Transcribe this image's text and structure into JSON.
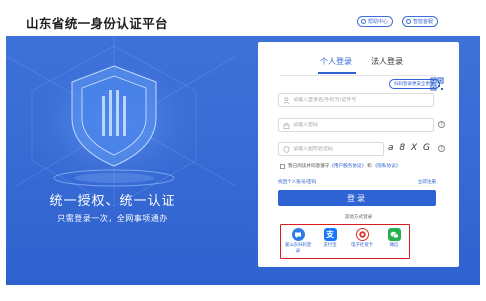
{
  "header": {
    "title": "山东省统一身份认证平台",
    "help_label": "帮助中心",
    "service_label": "智能客服"
  },
  "hero": {
    "slogan": "统一授权、统一认证",
    "subtitle": "只需登录一次，全网事项通办"
  },
  "login": {
    "tabs": [
      {
        "label": "个人登录",
        "active": true
      },
      {
        "label": "法人登录",
        "active": false
      }
    ],
    "qr_tip": "扫码登录更安全更便",
    "username_placeholder": "请输入登录名/手机号/证件号",
    "password_placeholder": "请输入密码",
    "captcha_placeholder": "请输入图形验证码",
    "captcha_text": "a 8 X G",
    "agreement": {
      "prefix": "我已阅读并同意遵守",
      "link1": "《用户服务协议》",
      "and": "和",
      "link2": "《隐私协议》"
    },
    "forgot_label": "找回个人账号/密码",
    "register_label": "立即注册",
    "submit_label": "登录",
    "other_methods_title": "其他方式登录",
    "methods": [
      {
        "label": "爱山东扫码登录",
        "icon": "chat-bubble-icon",
        "color": "#2f7be8"
      },
      {
        "label": "支付宝",
        "icon": "alipay-icon",
        "color": "#1677ff"
      },
      {
        "label": "电子社保卡",
        "icon": "social-security-card-icon",
        "color": "#d8322a"
      },
      {
        "label": "微信",
        "icon": "wechat-icon",
        "color": "#22b14c"
      }
    ]
  },
  "colors": {
    "brand_blue": "#2f63d1",
    "hero_blue": "#3f72d8",
    "highlight_red": "#d81e1e"
  }
}
